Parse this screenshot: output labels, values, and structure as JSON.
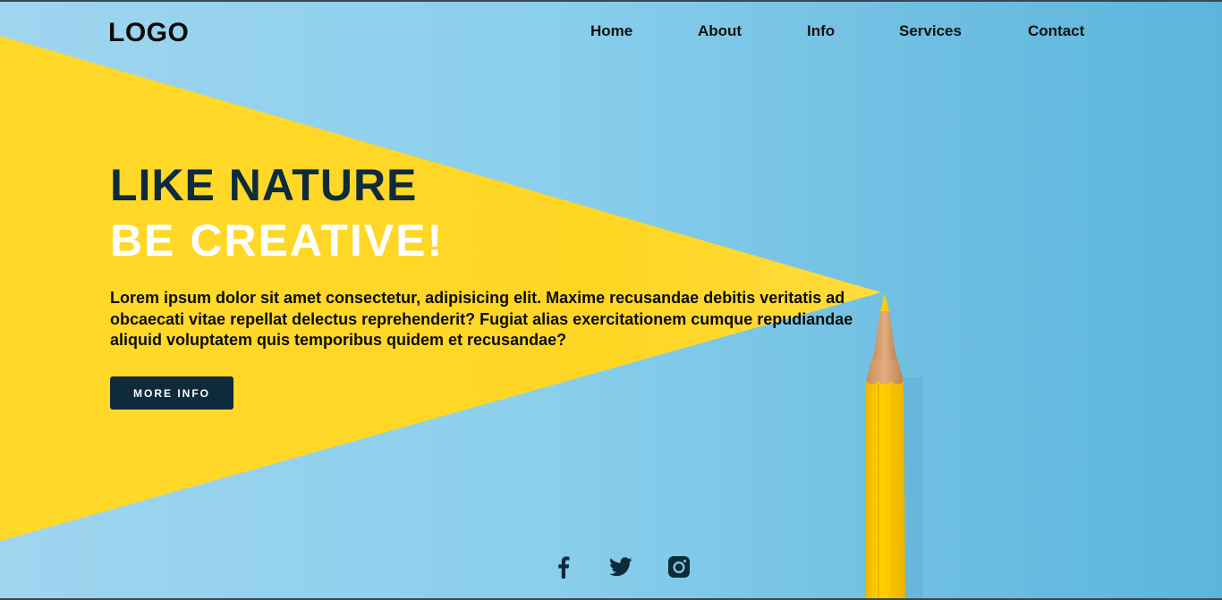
{
  "header": {
    "logo": "LOGO",
    "nav": [
      {
        "label": "Home"
      },
      {
        "label": "About"
      },
      {
        "label": "Info"
      },
      {
        "label": "Services"
      },
      {
        "label": "Contact"
      }
    ]
  },
  "hero": {
    "headline_primary": "LIKE NATURE",
    "headline_secondary": "BE CREATIVE!",
    "body": "Lorem ipsum dolor sit amet consectetur, adipisicing elit. Maxime recusandae debitis veritatis ad obcaecati vitae repellat delectus reprehenderit? Fugiat alias exercitationem cumque repudiandae aliquid voluptatem quis temporibus quidem et recusandae?",
    "cta_label": "MORE INFO"
  },
  "social": [
    {
      "icon": "facebook-icon"
    },
    {
      "icon": "twitter-icon"
    },
    {
      "icon": "instagram-icon"
    }
  ],
  "colors": {
    "sky": "#8acfec",
    "beam": "#ffd21f",
    "pencil": "#f7c300",
    "headline_dark": "#0f2a3a",
    "cta_bg": "#0f2a3a"
  }
}
